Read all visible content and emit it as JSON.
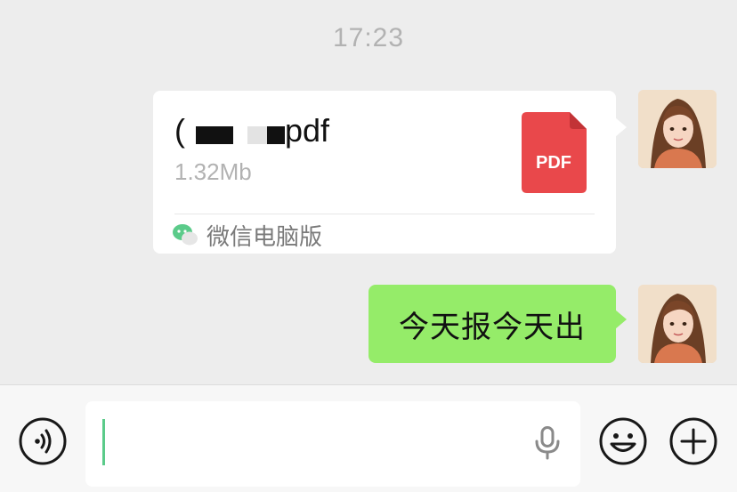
{
  "chat": {
    "timestamp": "17:23",
    "file_message": {
      "name_start": "(",
      "name_end": "pdf",
      "size": "1.32Mb",
      "type_badge": "PDF",
      "source": "微信电脑版"
    },
    "text_message": "今天报今天出"
  },
  "input_bar": {
    "value": "",
    "icons": [
      "voice-icon",
      "microphone-icon",
      "emoji-icon",
      "plus-icon"
    ]
  },
  "colors": {
    "background": "#ededed",
    "bubble_green": "#95ec69",
    "pdf_red": "#e9484b",
    "wechat_green": "#5bcb8a"
  }
}
